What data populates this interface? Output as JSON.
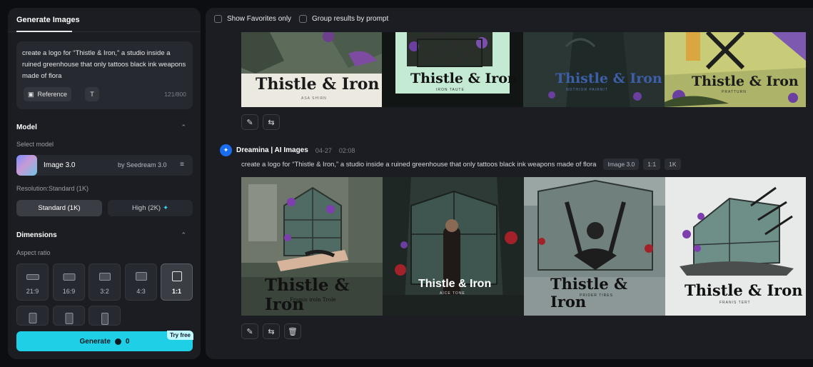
{
  "left_panel": {
    "tab": "Generate Images",
    "prompt": "create a logo for “Thistle & Iron,” a studio inside a ruined greenhouse that only tattoos black ink weapons made of flora",
    "reference_label": "Reference",
    "t_icon": "T",
    "counter": "121/800",
    "model_section": "Model",
    "select_model": "Select model",
    "model_name": "Image 3.0",
    "model_by": "by Seedream 3.0",
    "resolution_label": "Resolution:Standard (1K)",
    "res_standard": "Standard (1K)",
    "res_high": "High (2K)",
    "dimensions_section": "Dimensions",
    "aspect_ratio_label": "Aspect ratio",
    "aspects": [
      "21:9",
      "16:9",
      "3:2",
      "4:3",
      "1:1"
    ],
    "selected_aspect": "1:1",
    "generate_label": "Generate",
    "generate_cost": "0",
    "try_free": "Try free"
  },
  "right_panel": {
    "show_favorites": "Show Favorites only",
    "group_by_prompt": "Group results by prompt",
    "top_images": [
      {
        "logo_text": "Thistle & Iron",
        "sub_text": "ASA SHIRN"
      },
      {
        "logo_text": "Thistle & Iron",
        "sub_text": "IRON TAUTE"
      },
      {
        "logo_text": "Thistle & Iron",
        "sub_text": "NOTHIOR PAIRNIT"
      },
      {
        "logo_text": "Thistle & Iron",
        "sub_text": "PRATTURN"
      }
    ],
    "generation": {
      "author": "Dreamina | AI Images",
      "date": "04-27",
      "time": "02:08",
      "prompt": "create a logo for “Thistle & Iron,” a studio inside a ruined greenhouse that only tattoos black ink weapons made of flora",
      "chips": [
        "Image 3.0",
        "1:1",
        "1K"
      ],
      "images": [
        {
          "logo_text": "Thistle & Iron",
          "sub_text": "Framis iroln Trole"
        },
        {
          "logo_text": "Thistle & Iron",
          "sub_text": "AICE TONE"
        },
        {
          "logo_text": "Thistle & Iron",
          "sub_text": "PRIDER TIRES"
        },
        {
          "logo_text": "Thistle & Iron",
          "sub_text": "FRANIS TERT"
        }
      ]
    }
  }
}
